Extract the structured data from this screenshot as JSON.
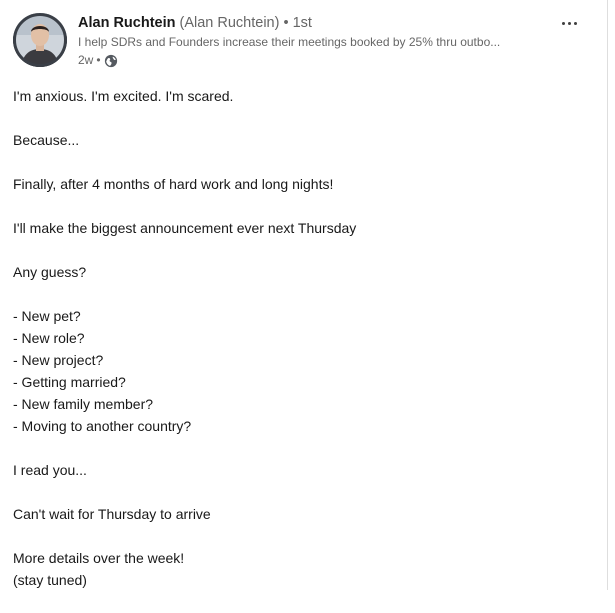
{
  "post": {
    "author_name": "Alan Ruchtein",
    "author_alias": "(Alan Ruchtein)",
    "separator": "•",
    "degree": "1st",
    "headline": "I help SDRs and Founders increase their meetings booked by 25% thru outbo...",
    "time": "2w",
    "time_separator": "•",
    "visibility_icon": "globe-icon",
    "more_icon": "more-horizontal-icon",
    "paragraphs": [
      [
        "I'm anxious. I'm excited. I'm scared."
      ],
      [
        "Because..."
      ],
      [
        "Finally, after 4 months of hard work and long nights!"
      ],
      [
        "I'll make the biggest announcement ever next Thursday"
      ],
      [
        "Any guess?"
      ],
      [
        "- New pet?",
        "- New role?",
        "- New project?",
        "- Getting married?",
        "- New family member?",
        "- Moving to another country?"
      ],
      [
        "I read you..."
      ],
      [
        "Can't wait for Thursday to arrive"
      ],
      [
        "More details over the week!",
        "(stay tuned)"
      ]
    ]
  },
  "colors": {
    "text_primary": "#191919",
    "text_secondary": "#666666",
    "background": "#ffffff"
  }
}
